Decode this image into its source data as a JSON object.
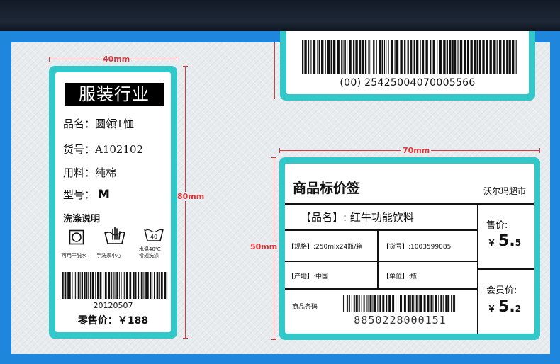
{
  "dimensions": {
    "left_width": "40mm",
    "left_height": "80mm",
    "price_width": "70mm",
    "price_height": "50mm"
  },
  "colors": {
    "frame_blue": "#1f86dd",
    "label_teal": "#32c7c9",
    "dimension_red": "#e0353a"
  },
  "garment_label": {
    "title": "服装行业",
    "name_line": "品名：圆领T恤",
    "item_no_line": "货号：A102102",
    "material_line": "用料：纯棉",
    "model_prefix": "型号：",
    "model_value": "M",
    "care_title": "洗涤说明",
    "care_items": [
      {
        "icon": "dry-clean-icon",
        "label": "可用干脱水"
      },
      {
        "icon": "hand-wash-icon",
        "label": "手洗须小心"
      },
      {
        "icon": "wash-40-icon",
        "label_line1": "水温40℃",
        "label_line2": "常规洗涤",
        "temp": "40"
      }
    ],
    "barcode_number": "20120507",
    "retail_price": "零售价：￥188"
  },
  "top_label": {
    "barcode_number": "(00) 25425004070005566"
  },
  "price_tag": {
    "title": "商品标价签",
    "store": "沃尔玛超市",
    "product_name": "【品名】: 红牛功能饮料",
    "spec": "【规格】:250mlx24瓶/箱",
    "item_no": "【货号】:1003599085",
    "origin": "【产地】:中国",
    "unit": "【单位】:瓶",
    "barcode_label": "商品条码",
    "barcode_number": "8850228000151",
    "price_label": "售价:",
    "price_yen": "￥",
    "price_int": "5.",
    "price_dec": "5",
    "member_label": "会员价:",
    "member_yen": "￥",
    "member_int": "5.",
    "member_dec": "2"
  }
}
